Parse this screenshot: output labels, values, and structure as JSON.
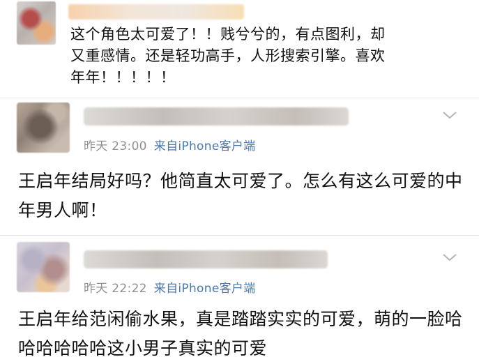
{
  "comments": [
    {
      "text": "这个角色太可爱了！！贱兮兮的，有点图利，却又重感情。还是轻功高手，人形搜索引擎。喜欢年年！！！！！"
    },
    {
      "time": "昨天 23:00",
      "source": "来自iPhone客户端",
      "text": "王启年结局好吗？他简直太可爱了。怎么有这么可爱的中年男人啊！"
    },
    {
      "time": "昨天 22:22",
      "source": "来自iPhone客户端",
      "text": "王启年给范闲偷水果，真是踏踏实实的可爱，萌的一脸哈哈哈哈哈哈这小男子真实的可爱"
    }
  ],
  "icons": {
    "chevron": "chevron-down-icon",
    "avatar": "avatar"
  },
  "colors": {
    "meta_text": "#8f8f8f",
    "source_link": "#4b78a9"
  }
}
